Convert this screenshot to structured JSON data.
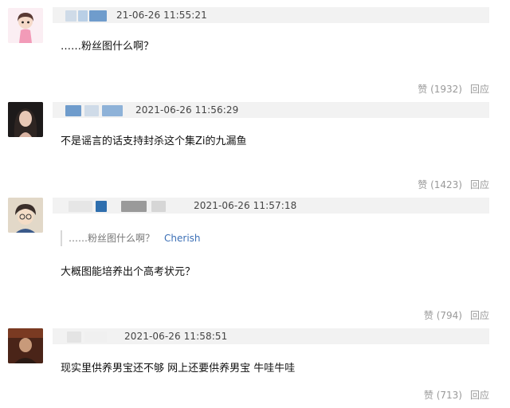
{
  "comments": [
    {
      "time": "21-06-26 11:55:21",
      "text": "……粉丝图什么啊？",
      "like_label": "赞",
      "like_count": "(1932)",
      "reply_label": "回应"
    },
    {
      "time": "2021-06-26 11:56:29",
      "text": "不是谣言的话支持封杀这个集Zi的九漏鱼",
      "like_label": "赞",
      "like_count": "(1423)",
      "reply_label": "回应"
    },
    {
      "time": "2021-06-26 11:57:18",
      "quote_text": "……粉丝图什么啊？",
      "quote_author": "Cherish",
      "text": "大概图能培养出个高考状元？",
      "like_label": "赞",
      "like_count": "(794)",
      "reply_label": "回应"
    },
    {
      "time": "2021-06-26 11:58:51",
      "text": "现实里供养男宝还不够 网上还要供养男宝 牛哇牛哇",
      "like_label": "赞",
      "like_count": "(713)",
      "reply_label": "回应"
    }
  ],
  "colors": {
    "meta_bar": "#f2f2f2",
    "action_text": "#999999",
    "quote_author": "#3b6fb6",
    "blur_blue": "#2f6fae"
  }
}
